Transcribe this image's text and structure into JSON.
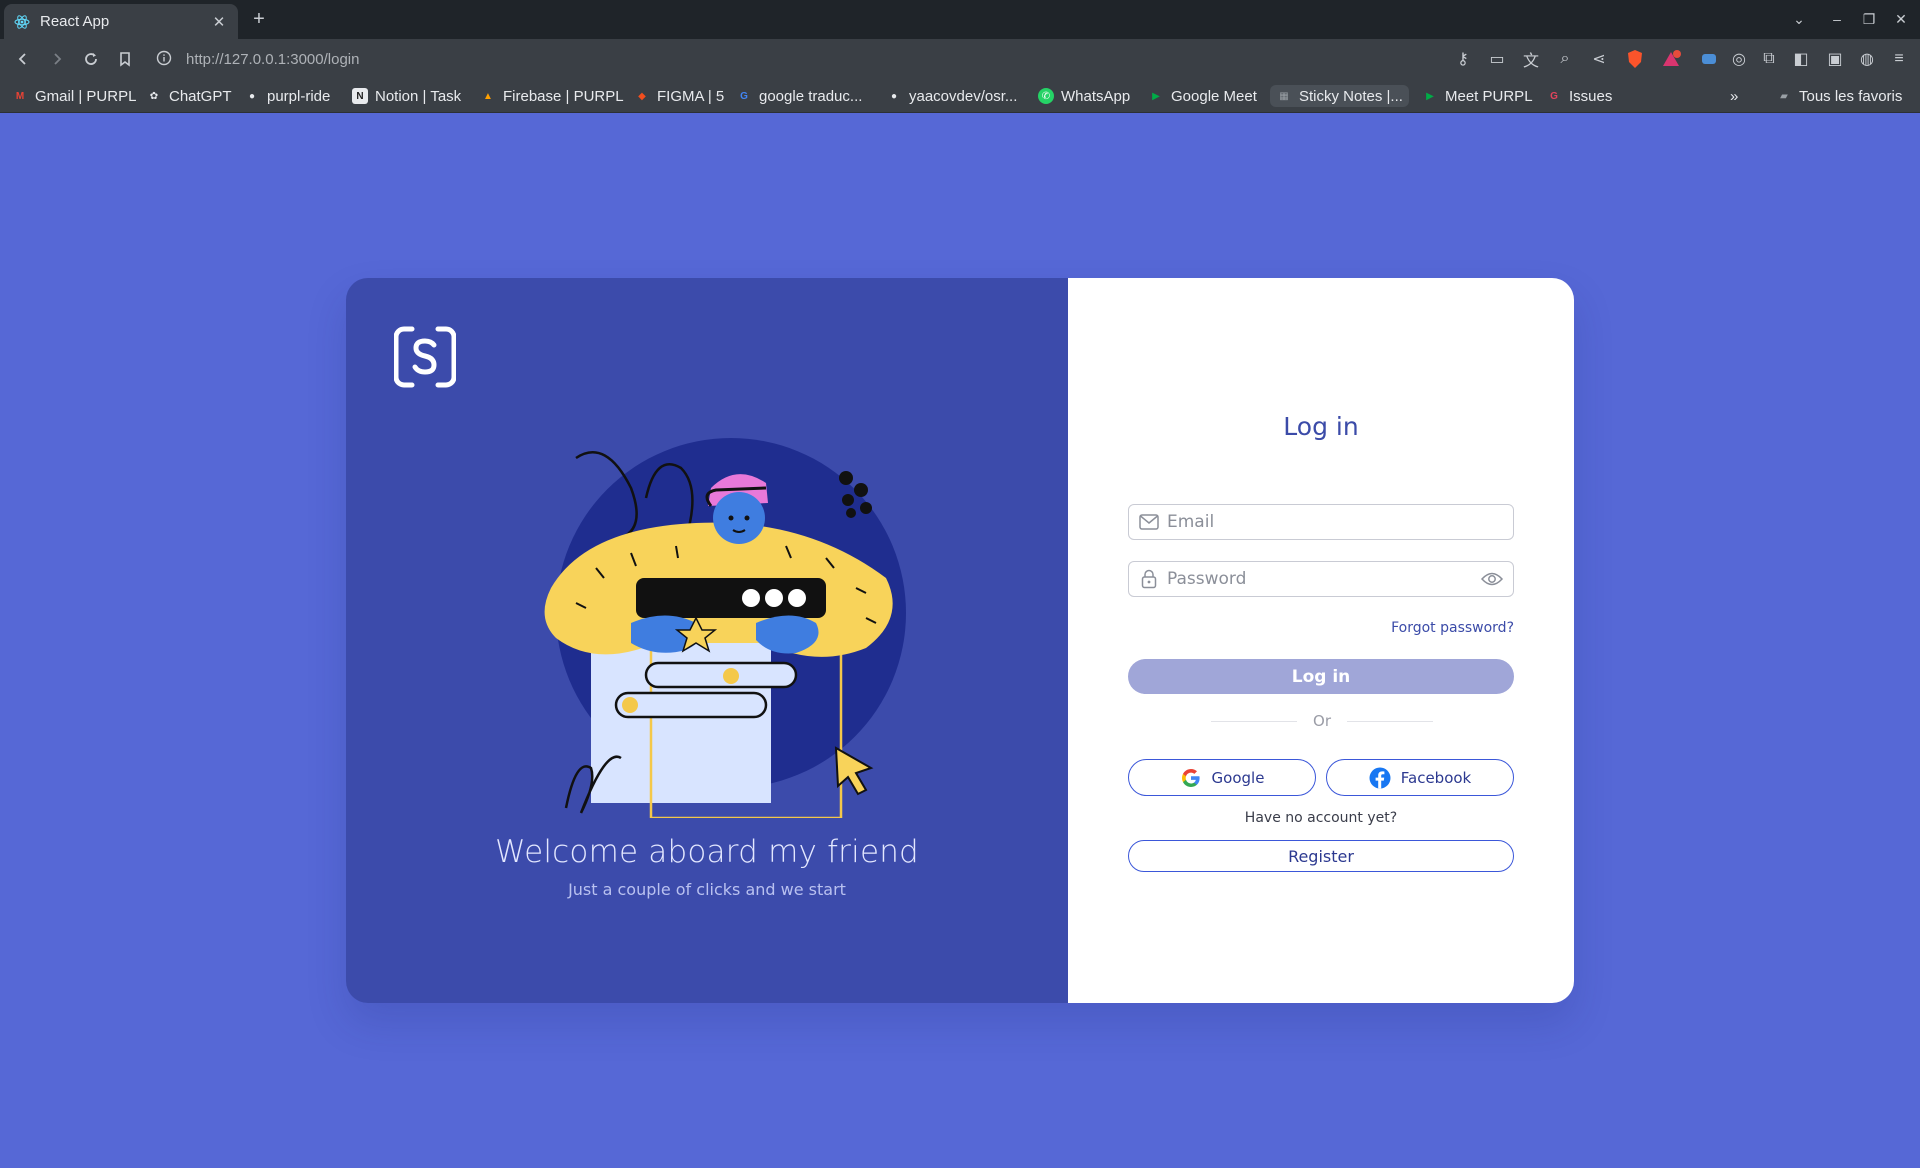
{
  "browser": {
    "tab_title": "React App",
    "url": "http://127.0.0.1:3000/login",
    "bookmarks": [
      {
        "label": "Gmail | PURPL",
        "icon": "gmail-icon",
        "color": "#ea4335"
      },
      {
        "label": "ChatGPT",
        "icon": "chatgpt-icon",
        "color": "#e8eaed"
      },
      {
        "label": "purpl-ride",
        "icon": "github-icon",
        "color": "#e8eaed"
      },
      {
        "label": "Notion | Task",
        "icon": "notion-icon",
        "color": "#e8eaed"
      },
      {
        "label": "Firebase | PURPL",
        "icon": "firebase-icon",
        "color": "#ffa000"
      },
      {
        "label": "FIGMA | 5",
        "icon": "figma-icon",
        "color": "#f24e1e"
      },
      {
        "label": "google traduc...",
        "icon": "google-icon",
        "color": "#4285f4"
      },
      {
        "label": "yaacovdev/osr...",
        "icon": "github-icon",
        "color": "#e8eaed"
      },
      {
        "label": "WhatsApp",
        "icon": "whatsapp-icon",
        "color": "#25d366"
      },
      {
        "label": "Google Meet",
        "icon": "meet-icon",
        "color": "#00ac47"
      },
      {
        "label": "Sticky Notes |...",
        "icon": "sticky-notes-icon",
        "color": "#9aa0a6"
      },
      {
        "label": "Meet PURPL",
        "icon": "meet-icon",
        "color": "#00ac47"
      },
      {
        "label": "Issues",
        "icon": "issues-icon",
        "color": "#e2445c"
      }
    ],
    "all_bookmarks": "Tous les favoris"
  },
  "login": {
    "welcome_title": "Welcome aboard my friend",
    "welcome_subtitle": "Just a couple of clicks and we start",
    "title": "Log in",
    "email_placeholder": "Email",
    "password_placeholder": "Password",
    "forgot_password": "Forgot password?",
    "login_button": "Log in",
    "or_label": "Or",
    "google_label": "Google",
    "facebook_label": "Facebook",
    "no_account": "Have no account yet?",
    "register_button": "Register"
  },
  "colors": {
    "page_bg": "#5668d6",
    "panel_bg": "#3c4bab",
    "accent": "#3b57d9",
    "login_button_disabled": "#a0a6d8"
  }
}
